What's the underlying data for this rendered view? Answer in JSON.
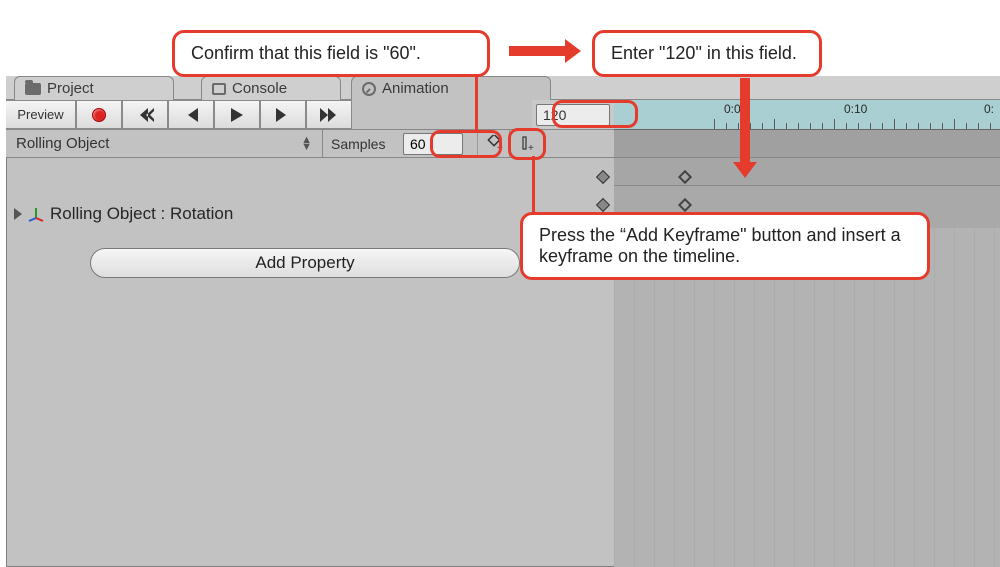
{
  "tabs": {
    "project": "Project",
    "console": "Console",
    "animation": "Animation"
  },
  "toolbar": {
    "preview_label": "Preview",
    "frame_value": "120"
  },
  "row2": {
    "clip_name": "Rolling Object",
    "samples_label": "Samples",
    "samples_value": "60"
  },
  "timeline": {
    "labels": [
      "0:00",
      "0:10",
      "0:"
    ]
  },
  "properties": {
    "track": "Rolling Object : Rotation",
    "add_property_label": "Add Property"
  },
  "annotations": {
    "confirm60": "Confirm that this field is \"60\".",
    "enter120": "Enter \"120\" in this field.",
    "addKeyframe": "Press the “Add Keyframe\" button and insert a keyframe on the timeline."
  },
  "colors": {
    "accent_red": "#e53b2c"
  }
}
